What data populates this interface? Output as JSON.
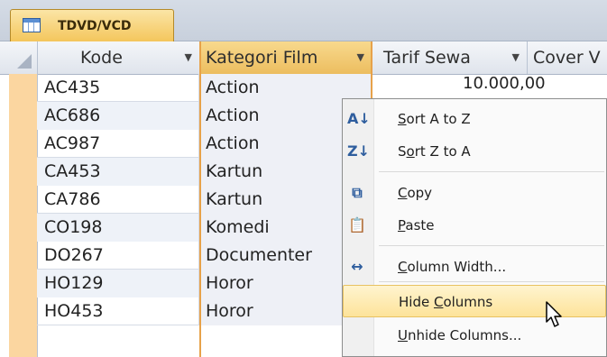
{
  "tab": {
    "title": "TDVD/VCD",
    "icon": "table-icon"
  },
  "columns": [
    {
      "label": "Kode",
      "has_dropdown": true
    },
    {
      "label": "Kategori Film",
      "has_dropdown": true
    },
    {
      "label": "Tarif Sewa",
      "has_dropdown": true
    },
    {
      "label": "Cover V",
      "has_dropdown": false
    }
  ],
  "rows": [
    {
      "kode": "AC435",
      "kategori": "Action"
    },
    {
      "kode": "AC686",
      "kategori": "Action"
    },
    {
      "kode": "AC987",
      "kategori": "Action"
    },
    {
      "kode": "CA453",
      "kategori": "Kartun"
    },
    {
      "kode": "CA786",
      "kategori": "Kartun"
    },
    {
      "kode": "CO198",
      "kategori": "Komedi"
    },
    {
      "kode": "DO267",
      "kategori": "Documenter"
    },
    {
      "kode": "HO129",
      "kategori": "Horor"
    },
    {
      "kode": "HO453",
      "kategori": "Horor"
    }
  ],
  "partial_tarif": "10.000,00",
  "context_menu": {
    "items": [
      {
        "label_pre": "",
        "label_u": "S",
        "label_post": "ort A to Z",
        "icon": "sort-ascending-icon",
        "icon_glyph": "A↓"
      },
      {
        "label_pre": "S",
        "label_u": "o",
        "label_post": "rt Z to A",
        "icon": "sort-descending-icon",
        "icon_glyph": "Z↓"
      },
      {
        "label_pre": "",
        "label_u": "C",
        "label_post": "opy",
        "icon": "copy-icon",
        "icon_glyph": "⧉"
      },
      {
        "label_pre": "",
        "label_u": "P",
        "label_post": "aste",
        "icon": "paste-icon",
        "icon_glyph": "📋"
      },
      {
        "label_pre": "",
        "label_u": "C",
        "label_post": "olumn Width...",
        "icon": "column-width-icon",
        "icon_glyph": "↔"
      },
      {
        "label_pre": "Hide ",
        "label_u": "C",
        "label_post": "olumns",
        "icon": "",
        "icon_glyph": ""
      },
      {
        "label_pre": "",
        "label_u": "U",
        "label_post": "nhide Columns...",
        "icon": "",
        "icon_glyph": ""
      }
    ],
    "highlighted_index": 5
  }
}
